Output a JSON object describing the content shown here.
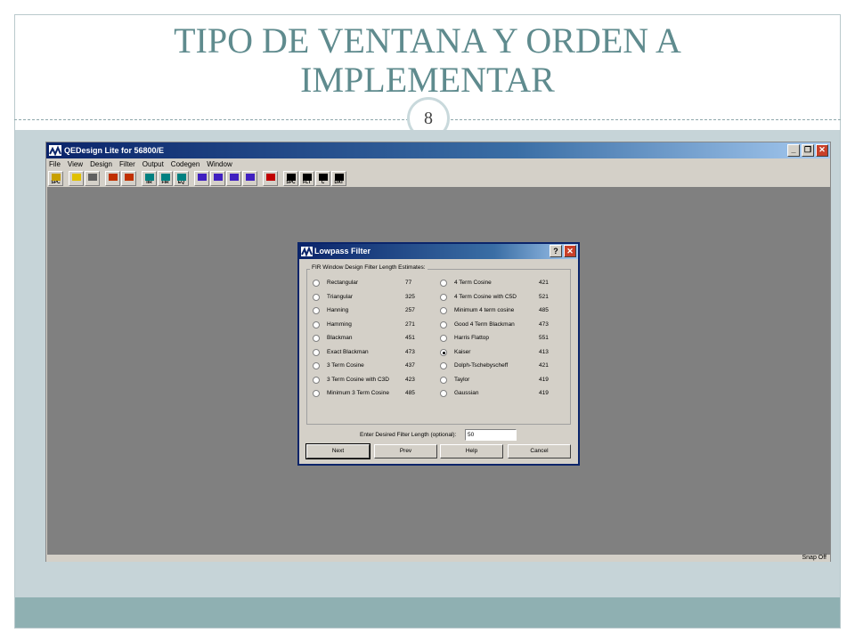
{
  "slide": {
    "title_line1": "TIPO DE VENTANA Y ORDEN A",
    "title_line2": "IMPLEMENTAR",
    "page_number": "8"
  },
  "app": {
    "title": "QEDesign Lite for 56800/E",
    "menu": [
      "File",
      "View",
      "Design",
      "Filter",
      "Output",
      "Codegen",
      "Window"
    ],
    "toolbar": [
      {
        "name": "spc-open",
        "label": "SPC",
        "icon": "folder-icon"
      },
      {
        "name": "help",
        "label": "",
        "icon": "help-icon"
      },
      {
        "name": "print",
        "label": "",
        "icon": "print-icon"
      },
      {
        "name": "edit",
        "label": "",
        "icon": "edit-icon"
      },
      {
        "name": "chart",
        "label": "",
        "icon": "chart-icon"
      },
      {
        "name": "iir",
        "label": "IIR",
        "icon": "iir-icon"
      },
      {
        "name": "fir",
        "label": "FIR",
        "icon": "fir-icon"
      },
      {
        "name": "eq",
        "label": "EQ",
        "icon": "eq-icon"
      },
      {
        "name": "lowpass",
        "label": "",
        "icon": "lowpass-icon"
      },
      {
        "name": "highpass",
        "label": "",
        "icon": "highpass-icon"
      },
      {
        "name": "bandpass",
        "label": "",
        "icon": "bandpass-icon"
      },
      {
        "name": "bandstop",
        "label": "",
        "icon": "bandstop-icon"
      },
      {
        "name": "arrow",
        "label": "",
        "icon": "double-arrow-icon"
      },
      {
        "name": "save-spc",
        "label": "SPC",
        "icon": "disk-icon"
      },
      {
        "name": "save-flt",
        "label": "FLT",
        "icon": "disk-icon"
      },
      {
        "name": "save-c",
        "label": "C",
        "icon": "disk-icon"
      },
      {
        "name": "save-dat",
        "label": "DAT",
        "icon": "disk-icon"
      }
    ],
    "status": "Snap Off"
  },
  "dialog": {
    "title": "Lowpass Filter",
    "group_label": "FIR Window Design Filter Length Estimates:",
    "left_options": [
      {
        "name": "Rectangular",
        "value": "77",
        "checked": false
      },
      {
        "name": "Triangular",
        "value": "325",
        "checked": false
      },
      {
        "name": "Hanning",
        "value": "257",
        "checked": false
      },
      {
        "name": "Hamming",
        "value": "271",
        "checked": false
      },
      {
        "name": "Blackman",
        "value": "451",
        "checked": false
      },
      {
        "name": "Exact Blackman",
        "value": "473",
        "checked": false
      },
      {
        "name": "3 Term Cosine",
        "value": "437",
        "checked": false
      },
      {
        "name": "3 Term Cosine with C3D",
        "value": "423",
        "checked": false
      },
      {
        "name": "Minimum 3 Term Cosine",
        "value": "485",
        "checked": false
      }
    ],
    "right_options": [
      {
        "name": "4 Term Cosine",
        "value": "421",
        "checked": false
      },
      {
        "name": "4 Term Cosine with C5D",
        "value": "521",
        "checked": false
      },
      {
        "name": "Minimum 4 term cosine",
        "value": "485",
        "checked": false
      },
      {
        "name": "Good 4 Term Blackman",
        "value": "473",
        "checked": false
      },
      {
        "name": "Harris Flattop",
        "value": "551",
        "checked": false
      },
      {
        "name": "Kaiser",
        "value": "413",
        "checked": true
      },
      {
        "name": "Dolph-Tschebyscheff",
        "value": "421",
        "checked": false
      },
      {
        "name": "Taylor",
        "value": "419",
        "checked": false
      },
      {
        "name": "Gaussian",
        "value": "419",
        "checked": false
      }
    ],
    "length_label": "Enter Desired Filter Length (optional):",
    "length_value": "50",
    "buttons": {
      "next": "Next",
      "prev": "Prev",
      "help": "Help",
      "cancel": "Cancel"
    }
  },
  "colors": {
    "title_teal": "#5f8b8e",
    "titlebar_blue": "#0a246a",
    "mdi_gray": "#808080",
    "band_teal": "#8fb0b2"
  }
}
